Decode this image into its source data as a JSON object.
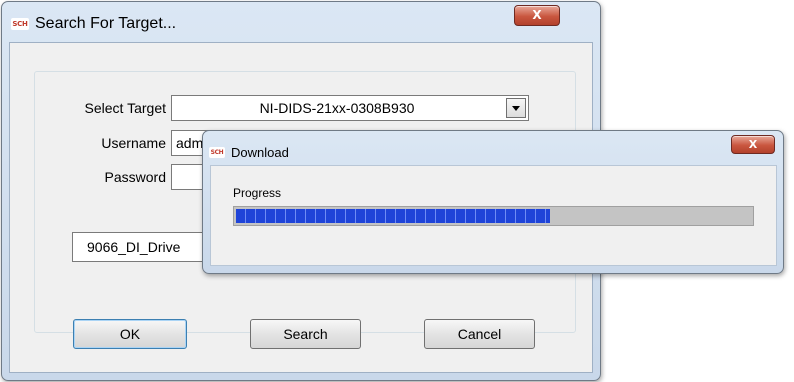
{
  "main_window": {
    "title": "Search For Target...",
    "icon_text": "SCH",
    "close_label": "X"
  },
  "form": {
    "select_target_label": "Select Target",
    "select_target_value": "NI-DIDS-21xx-0308B930",
    "username_label": "Username",
    "username_value": "adm",
    "password_label": "Password",
    "password_value": "",
    "driver_value": "9066_DI_Drive"
  },
  "buttons": {
    "ok": "OK",
    "search": "Search",
    "cancel": "Cancel"
  },
  "download_dialog": {
    "title": "Download",
    "icon_text": "SCH",
    "close_label": "X",
    "progress_label": "Progress",
    "progress_fraction": 0.61
  },
  "colors": {
    "progress_fill": "#1f44d8",
    "close_button": "#c9563f",
    "frame": "#c9d8ea"
  }
}
